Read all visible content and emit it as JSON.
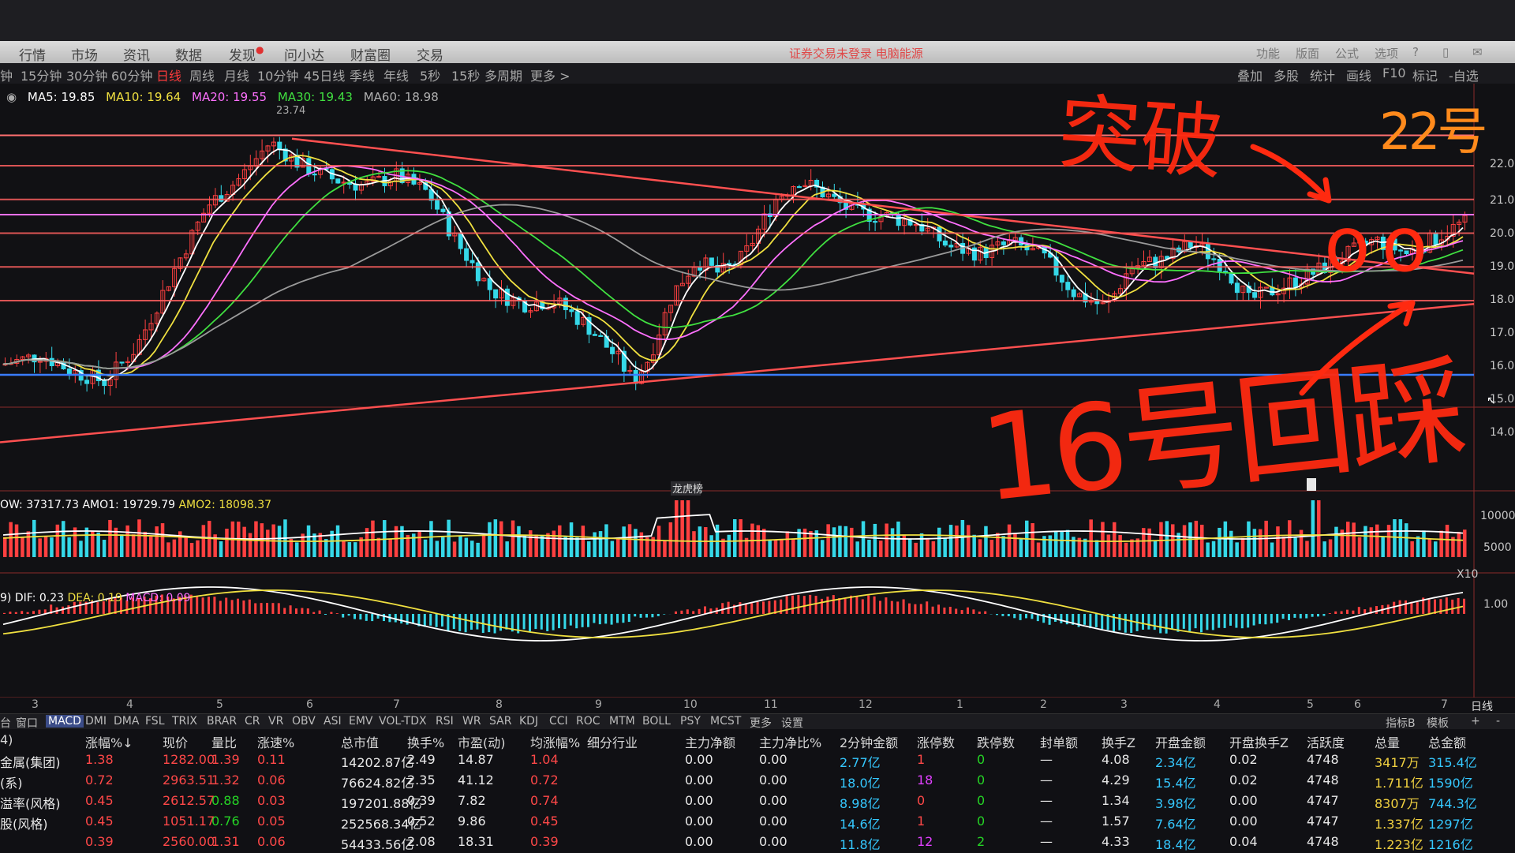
{
  "menu": {
    "items": [
      "行情",
      "市场",
      "资讯",
      "数据",
      "发现",
      "问小达",
      "财富圈",
      "交易"
    ],
    "warning": "证券交易未登录  电脑能源",
    "right_items": [
      "功能",
      "版面",
      "公式",
      "选项"
    ]
  },
  "periods": {
    "items": [
      "钟",
      "15分钟",
      "30分钟",
      "60分钟",
      "日线",
      "周线",
      "月线",
      "10分钟",
      "45日线",
      "季线",
      "年线",
      "5秒",
      "15秒",
      "多周期",
      "更多 >"
    ],
    "active": "日线",
    "right_tools": [
      "叠加",
      "多股",
      "统计",
      "画线",
      "F10",
      "标记",
      "-自选"
    ]
  },
  "ma_legend": {
    "ma5": "MA5: 19.85",
    "ma10": "MA10: 19.64",
    "ma20": "MA20: 19.55",
    "ma30": "MA30: 19.43",
    "ma60": "MA60: 18.98",
    "colors": {
      "ma5": "#ffffff",
      "ma10": "#f0e040",
      "ma20": "#ff70ff",
      "ma30": "#40e040",
      "ma60": "#9a9a9a"
    }
  },
  "chart_data": {
    "type": "candlestick",
    "price_axis": [
      "22.0",
      "21.0",
      "20.0",
      "19.0",
      "18.0",
      "17.00",
      "16.00",
      "15.00",
      "14.00"
    ],
    "high_label": "23.74",
    "volume_axis": [
      "10000",
      "5000",
      "X10"
    ],
    "macd_axis": [
      "1.00"
    ],
    "markers": [
      "龙虎榜"
    ],
    "volume_legend": {
      "vol": "OW: 37317.73",
      "amo1": "AMO1: 19729.79",
      "amo2": "AMO2: 18098.37"
    },
    "macd_legend": {
      "prefix": "9)",
      "dif": "DIF: 0.23",
      "dea": "DEA: 0.19",
      "macd": "MACD: 0.09"
    },
    "timeline": [
      "3",
      "4",
      "5",
      "6",
      "7",
      "8",
      "9",
      "10",
      "11",
      "12",
      "1",
      "2",
      "3",
      "4",
      "5",
      "6",
      "7"
    ],
    "timeline_right": "日线"
  },
  "annotations": {
    "breakout": "突破",
    "date_22": "22号",
    "retest_16": "16号回踩",
    "circles": "oo"
  },
  "tabs": {
    "items": [
      "台",
      "窗口",
      "MACD",
      "DMI",
      "DMA",
      "FSL",
      "TRIX",
      "BRAR",
      "CR",
      "VR",
      "OBV",
      "ASI",
      "EMV",
      "VOL-TDX",
      "RSI",
      "WR",
      "SAR",
      "KDJ",
      "CCI",
      "ROC",
      "MTM",
      "BOLL",
      "PSY",
      "MCST",
      "更多",
      "设置"
    ],
    "active": "MACD",
    "right_items": [
      "指标B",
      "模板",
      "+",
      "-"
    ]
  },
  "table": {
    "headers": [
      "4)",
      "涨幅%↓",
      "现价",
      "量比",
      "涨速%",
      "总市值",
      "换手%",
      "市盈(动)",
      "均涨幅%",
      "细分行业",
      "主力净额",
      "主力净比%",
      "2分钟金额",
      "涨停数",
      "跌停数",
      "封单额",
      "换手Z",
      "开盘金额",
      "开盘换手Z",
      "活跃度",
      "总量",
      "总金额"
    ],
    "rows": [
      [
        "金属(集团)",
        "1.38",
        "1282.00",
        "1.39",
        "0.11",
        "14202.87亿",
        "2.49",
        "14.87",
        "1.04",
        "",
        "0.00",
        "0.00",
        "2.77亿",
        "1",
        "0",
        "—",
        "4.08",
        "2.34亿",
        "0.02",
        "4748",
        "3417万",
        "315.4亿"
      ],
      [
        "(系)",
        "0.72",
        "2963.51",
        "1.32",
        "0.06",
        "76624.82亿",
        "2.35",
        "41.12",
        "0.72",
        "",
        "0.00",
        "0.00",
        "18.0亿",
        "18",
        "0",
        "—",
        "4.29",
        "15.4亿",
        "0.02",
        "4748",
        "1.711亿",
        "1590亿"
      ],
      [
        "溢率(风格)",
        "0.45",
        "2612.57",
        "0.88",
        "0.03",
        "197201.88亿",
        "0.39",
        "7.82",
        "0.74",
        "",
        "0.00",
        "0.00",
        "8.98亿",
        "0",
        "0",
        "—",
        "1.34",
        "3.98亿",
        "0.00",
        "4747",
        "8307万",
        "744.3亿"
      ],
      [
        "股(风格)",
        "0.45",
        "1051.17",
        "0.76",
        "0.05",
        "252568.34亿",
        "0.52",
        "9.86",
        "0.45",
        "",
        "0.00",
        "0.00",
        "14.6亿",
        "1",
        "0",
        "—",
        "1.57",
        "7.64亿",
        "0.00",
        "4747",
        "1.337亿",
        "1297亿"
      ],
      [
        "",
        "0.39",
        "2560.00",
        "1.31",
        "0.06",
        "54433.56亿",
        "2.08",
        "18.31",
        "0.39",
        "",
        "0.00",
        "0.00",
        "11.8亿",
        "12",
        "2",
        "—",
        "4.33",
        "18.4亿",
        "0.04",
        "4748",
        "1.223亿",
        "1216亿"
      ]
    ]
  }
}
